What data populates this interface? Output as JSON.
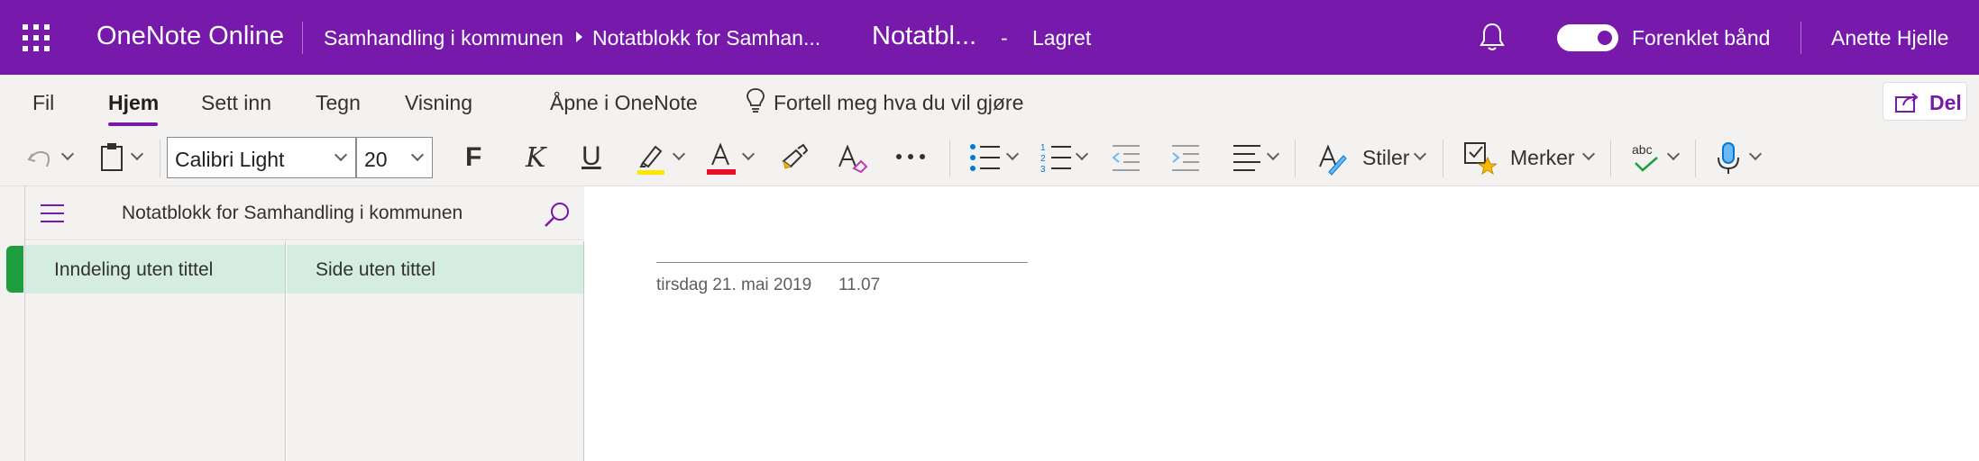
{
  "titlebar": {
    "app_name": "OneNote Online",
    "breadcrumb": [
      "Samhandling i kommunen",
      "Notatblokk for Samhan..."
    ],
    "page_title": "Notatbl...",
    "separator": "-",
    "save_status": "Lagret",
    "simplified_ribbon_label": "Forenklet bånd",
    "simplified_ribbon_on": true,
    "user_name": "Anette Hjelle",
    "color": "#7719aa"
  },
  "ribbon": {
    "tabs": [
      "Fil",
      "Hjem",
      "Sett inn",
      "Tegn",
      "Visning"
    ],
    "active_tab": "Hjem",
    "open_in_app": "Åpne i OneNote",
    "tell_me": "Fortell meg hva du vil gjøre",
    "share": "Del"
  },
  "toolbar": {
    "font_name": "Calibri Light",
    "font_size": "20",
    "bold": "F",
    "italic": "K",
    "underline": "U",
    "highlight_color": "#ffe600",
    "font_color": "#e81123",
    "styles_label": "Stiler",
    "tags_label": "Merker",
    "spell_label": "abc",
    "icons": [
      "undo-icon",
      "clipboard-icon",
      "highlighter-icon",
      "font-color-icon",
      "format-painter-icon",
      "clear-formatting-icon",
      "more-icon",
      "bullets-icon",
      "numbering-icon",
      "outdent-icon",
      "indent-icon",
      "align-icon",
      "styles-icon",
      "tag-icon",
      "spelling-icon",
      "dictate-icon"
    ]
  },
  "nav": {
    "notebook_title": "Notatblokk for Samhandling i kommunen",
    "section_color": "#1e9e3f",
    "sections": [
      {
        "label": "Inndeling uten tittel",
        "selected": true
      }
    ],
    "pages": [
      {
        "label": "Side uten tittel",
        "selected": true
      }
    ]
  },
  "page": {
    "date": "tirsdag 21. mai 2019",
    "time": "11.07"
  }
}
